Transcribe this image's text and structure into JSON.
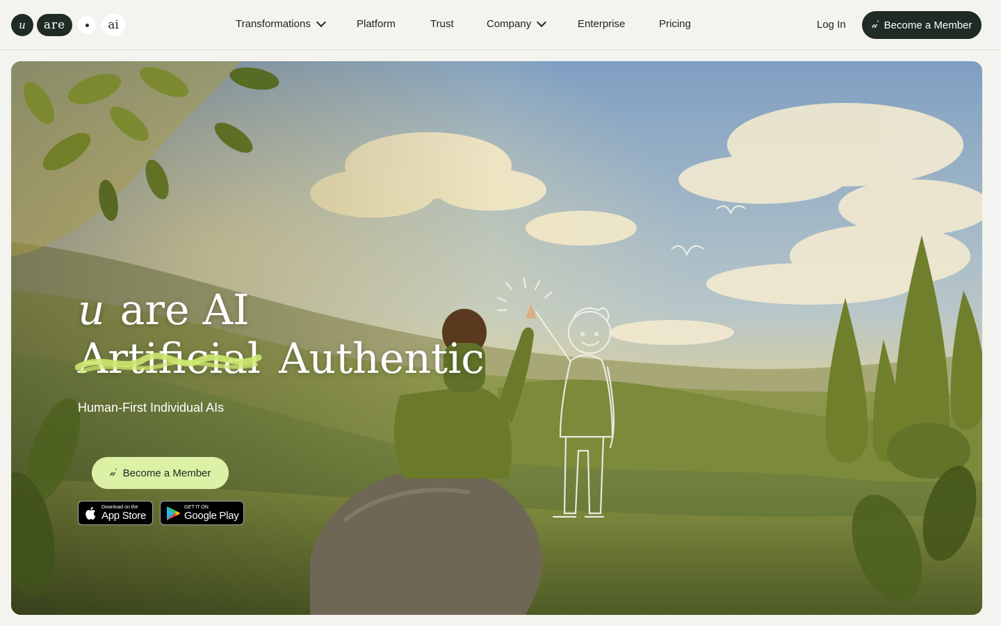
{
  "nav": {
    "logo": {
      "mark": "u",
      "word1": "are",
      "word2": "ai"
    },
    "menu": [
      {
        "label": "Transformations",
        "has_dropdown": true
      },
      {
        "label": "Platform",
        "has_dropdown": false
      },
      {
        "label": "Trust",
        "has_dropdown": false
      },
      {
        "label": "Company",
        "has_dropdown": true
      },
      {
        "label": "Enterprise",
        "has_dropdown": false
      },
      {
        "label": "Pricing",
        "has_dropdown": false
      }
    ],
    "login_label": "Log In",
    "cta_label": "Become a Member",
    "cta_icon": "u-mark-icon"
  },
  "hero": {
    "headline_mark": "u",
    "headline_line1": "are AI",
    "headline_struck": "Artificial",
    "headline_word": "Authentic",
    "subtitle": "Human-First Individual AIs",
    "cta_label": "Become a Member",
    "app_store": {
      "small": "Download on the",
      "big": "App Store"
    },
    "google_play": {
      "small": "GET IT ON",
      "big": "Google Play"
    }
  },
  "colors": {
    "dark": "#1f2b24",
    "accent_lime": "#dcf0a6",
    "page_bg": "#f3f3ef",
    "scribble": "#cde870"
  }
}
